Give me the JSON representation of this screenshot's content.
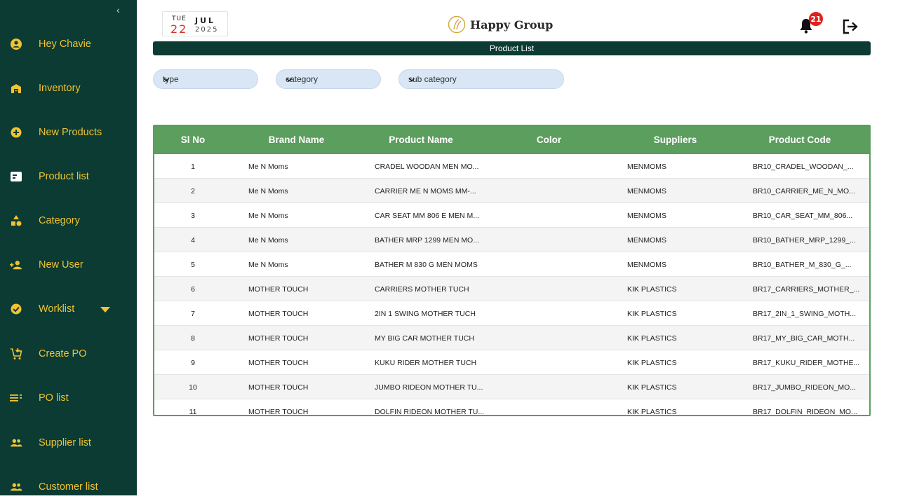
{
  "sidebar": {
    "collapse_glyph": "‹",
    "items": [
      {
        "label": "Hey Chavie",
        "icon": "user-circle-icon"
      },
      {
        "label": "Inventory",
        "icon": "warehouse-icon"
      },
      {
        "label": "New Products",
        "icon": "plus-circle-icon"
      },
      {
        "label": "Product list",
        "icon": "card-list-icon"
      },
      {
        "label": "Category",
        "icon": "category-shapes-icon"
      },
      {
        "label": "New User",
        "icon": "add-user-icon"
      },
      {
        "label": "Worklist",
        "icon": "check-circle-icon"
      },
      {
        "label": "Create PO",
        "icon": "cart-add-icon"
      },
      {
        "label": "PO list",
        "icon": "list-icon"
      },
      {
        "label": "Supplier list",
        "icon": "people-icon"
      },
      {
        "label": "Customer list",
        "icon": "people-icon"
      }
    ]
  },
  "header": {
    "date": {
      "day": "TUE",
      "date": "22",
      "month": "JUL",
      "year": "2025"
    },
    "brand": "Happy Group",
    "notification_count": "21"
  },
  "page": {
    "title": "Product List"
  },
  "filters": {
    "type": "type",
    "category": "category",
    "sub_category": "sub category"
  },
  "table": {
    "columns": [
      "Sl No",
      "Brand Name",
      "Product Name",
      "Color",
      "Suppliers",
      "Product Code"
    ],
    "rows": [
      [
        "1",
        "Me N Moms",
        "CRADEL WOODAN MEN MO...",
        "",
        "MENMOMS",
        "BR10_CRADEL_WOODAN_..."
      ],
      [
        "2",
        "Me N Moms",
        "CARRIER ME N MOMS MM-...",
        "",
        "MENMOMS",
        "BR10_CARRIER_ME_N_MO..."
      ],
      [
        "3",
        "Me N Moms",
        "CAR SEAT MM 806 E MEN M...",
        "",
        "MENMOMS",
        "BR10_CAR_SEAT_MM_806..."
      ],
      [
        "4",
        "Me N Moms",
        "BATHER MRP 1299 MEN MO...",
        "",
        "MENMOMS",
        "BR10_BATHER_MRP_1299_..."
      ],
      [
        "5",
        "Me N Moms",
        "BATHER M 830 G MEN MOMS",
        "",
        "MENMOMS",
        "BR10_BATHER_M_830_G_..."
      ],
      [
        "6",
        "MOTHER TOUCH",
        "CARRIERS MOTHER TUCH",
        "",
        "KIK PLASTICS",
        "BR17_CARRIERS_MOTHER_..."
      ],
      [
        "7",
        "MOTHER TOUCH",
        "2IN 1 SWING MOTHER TUCH",
        "",
        "KIK PLASTICS",
        "BR17_2IN_1_SWING_MOTH..."
      ],
      [
        "8",
        "MOTHER TOUCH",
        "MY BIG CAR MOTHER TUCH",
        "",
        "KIK PLASTICS",
        "BR17_MY_BIG_CAR_MOTH..."
      ],
      [
        "9",
        "MOTHER TOUCH",
        "KUKU RIDER MOTHER TUCH",
        "",
        "KIK PLASTICS",
        "BR17_KUKU_RIDER_MOTHE..."
      ],
      [
        "10",
        "MOTHER TOUCH",
        "JUMBO RIDEON MOTHER TU...",
        "",
        "KIK PLASTICS",
        "BR17_JUMBO_RIDEON_MO..."
      ],
      [
        "11",
        "MOTHER TOUCH",
        "DOLFIN RIDEON MOTHER TU...",
        "",
        "KIK PLASTICS",
        "BR17_DOLFIN_RIDEON_MO..."
      ]
    ]
  },
  "colors": {
    "sidebar_bg": "#0b3b32",
    "sidebar_text": "#f1c232",
    "table_header": "#5b9e5e",
    "badge": "#e0201b",
    "date_red": "#d93025"
  }
}
